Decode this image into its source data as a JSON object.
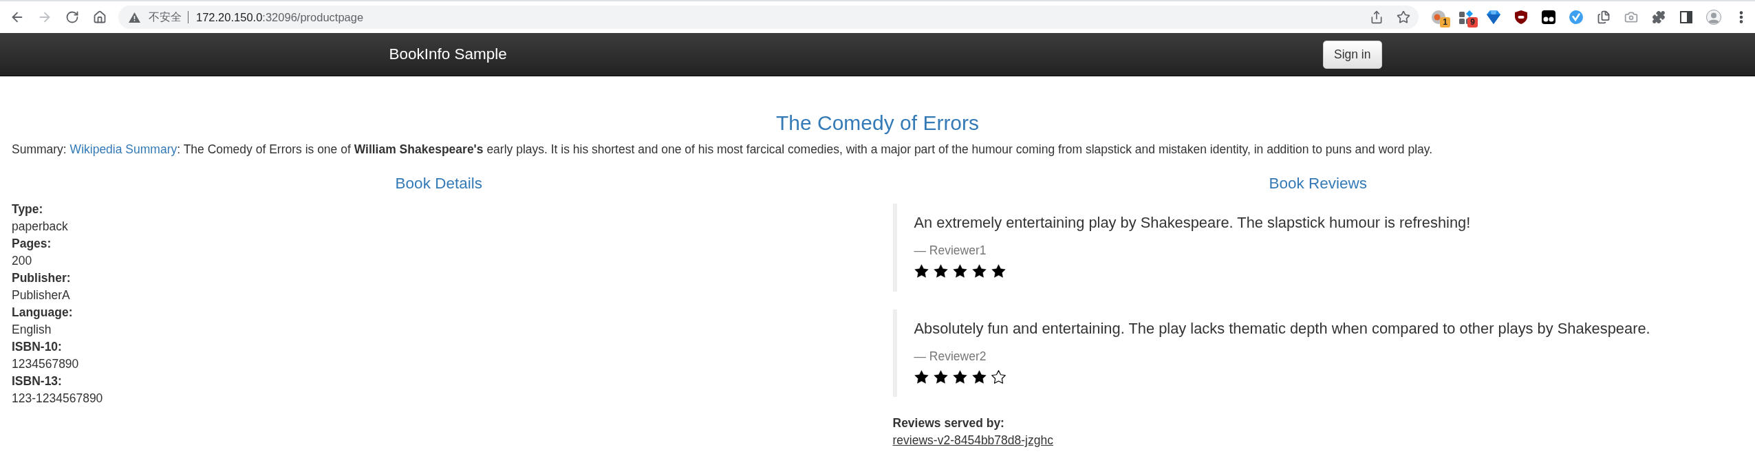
{
  "browser": {
    "forward_disabled": true,
    "security_label": "不安全",
    "url_host": "172.20.150.0",
    "url_path": ":32096/productpage",
    "extension_badges": [
      {
        "text": "1",
        "color": "#f2a93b"
      },
      {
        "text": "9",
        "color": "#e8453c"
      }
    ]
  },
  "navbar": {
    "brand": "BookInfo Sample",
    "sign_in": "Sign in"
  },
  "product": {
    "title": "The Comedy of Errors",
    "summary": {
      "label": "Summary:",
      "link": "Wikipedia Summary",
      "text": ": The Comedy of Errors is one of **William Shakespeare's** early plays. It is his shortest and one of his most farcical comedies, with a major part of the humour coming from slapstick and mistaken identity, in addition to puns and word play."
    }
  },
  "details": {
    "heading": "Book Details",
    "items": [
      {
        "label": "Type:",
        "value": "paperback"
      },
      {
        "label": "Pages:",
        "value": "200"
      },
      {
        "label": "Publisher:",
        "value": "PublisherA"
      },
      {
        "label": "Language:",
        "value": "English"
      },
      {
        "label": "ISBN-10:",
        "value": "1234567890"
      },
      {
        "label": "ISBN-13:",
        "value": "123-1234567890"
      }
    ]
  },
  "reviews": {
    "heading": "Book Reviews",
    "items": [
      {
        "text": "An extremely entertaining play by Shakespeare. The slapstick humour is refreshing!",
        "reviewer": "— Reviewer1",
        "stars": 5
      },
      {
        "text": "Absolutely fun and entertaining. The play lacks thematic depth when compared to other plays by Shakespeare.",
        "reviewer": "— Reviewer2",
        "stars": 4
      }
    ],
    "served_by": {
      "label": "Reviews served by:",
      "value": "reviews-v2-8454bb78d8-jzghc"
    }
  }
}
